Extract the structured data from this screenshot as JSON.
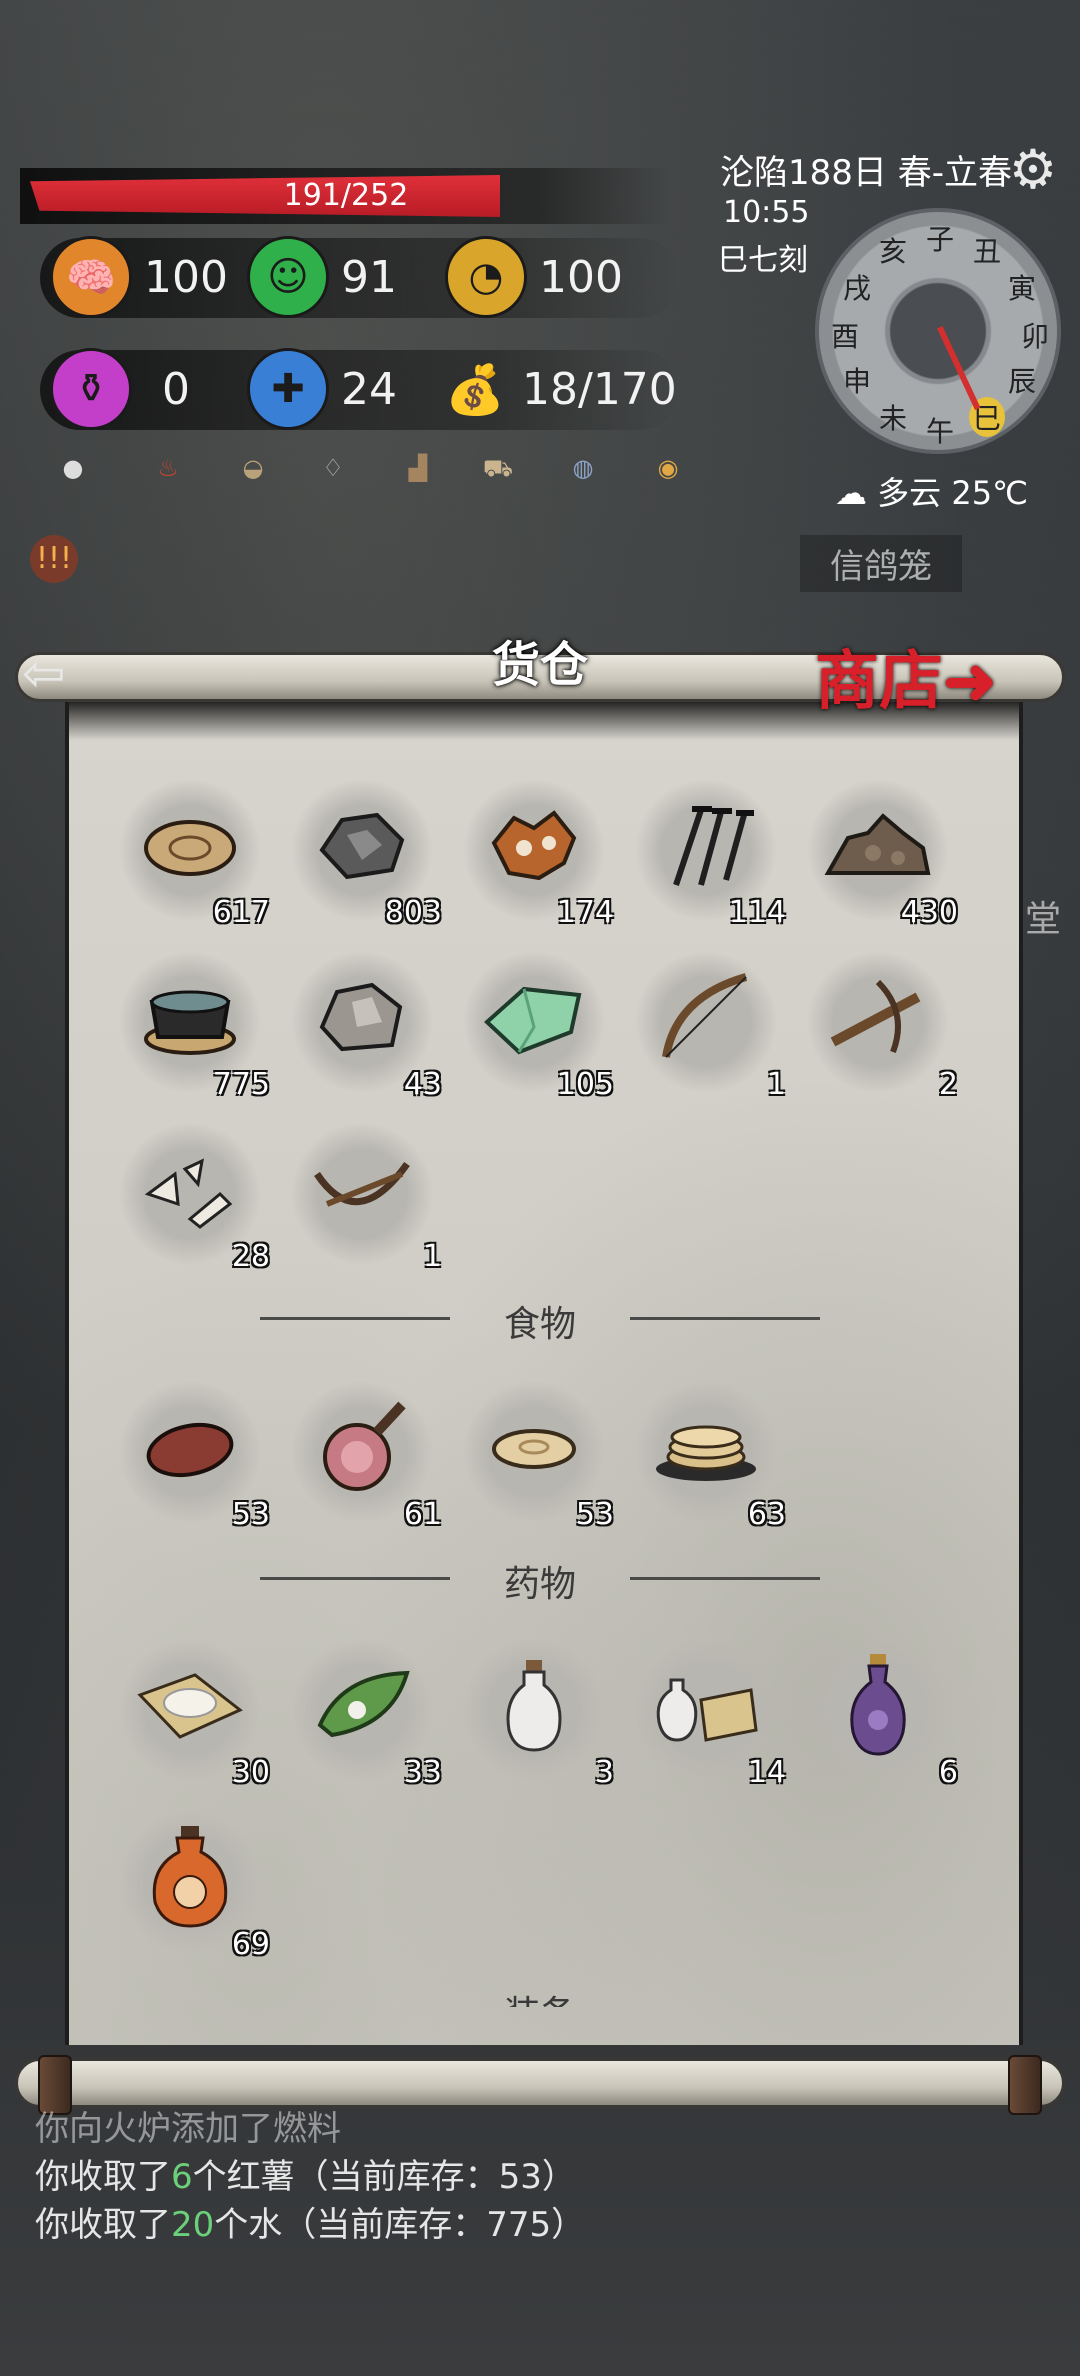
{
  "hud": {
    "hp": "191/252",
    "stats": [
      {
        "name": "brain-icon",
        "value": "100",
        "color": "#e2862c"
      },
      {
        "name": "smile-icon",
        "value": "91",
        "color": "#2fb04a"
      },
      {
        "name": "stomach-icon",
        "value": "100",
        "color": "#d9a52a"
      },
      {
        "name": "potion-icon",
        "value": "0",
        "color": "#c43fc9"
      },
      {
        "name": "bandage-icon",
        "value": "24",
        "color": "#3a7fd6"
      },
      {
        "name": "sack-icon",
        "value": "18/170",
        "color": "#9aa6b4"
      }
    ],
    "mini_icons": [
      "pill-icon",
      "flame-icon",
      "bread-icon",
      "vase-icon",
      "boots-icon",
      "cart-icon",
      "bag-icon",
      "lantern-icon"
    ],
    "warning_badge": "!!!"
  },
  "clock": {
    "date": "沦陷188日 春-立春",
    "time": "10:55",
    "shichen": "巳七刻",
    "weather": "多云",
    "temperature": "25℃",
    "dial_chars": [
      "子",
      "丑",
      "寅",
      "卯",
      "辰",
      "巳",
      "午",
      "未",
      "申",
      "酉",
      "戌",
      "亥"
    ]
  },
  "map": {
    "cage_label": "信鸽笼",
    "side_label": "堂"
  },
  "panel": {
    "title": "货仓",
    "shop_label": "商店➜",
    "materials": [
      {
        "name": "wood-slice",
        "count": "617",
        "glyph": "🪵"
      },
      {
        "name": "coal",
        "count": "803",
        "glyph": "🪨"
      },
      {
        "name": "leather",
        "count": "174",
        "glyph": "🦊"
      },
      {
        "name": "nails",
        "count": "114",
        "glyph": "📌"
      },
      {
        "name": "ore-pile",
        "count": "430",
        "glyph": "⛰"
      },
      {
        "name": "water-bowl",
        "count": "775",
        "glyph": "🥣"
      },
      {
        "name": "stone",
        "count": "43",
        "glyph": "🪨"
      },
      {
        "name": "jade",
        "count": "105",
        "glyph": "💎"
      },
      {
        "name": "bow",
        "count": "1",
        "glyph": "🏹"
      },
      {
        "name": "crossbow",
        "count": "2",
        "glyph": "⚔"
      },
      {
        "name": "shards",
        "count": "28",
        "glyph": "✂"
      },
      {
        "name": "small-crossbow",
        "count": "1",
        "glyph": "🏹"
      }
    ],
    "food_header": "食物",
    "food": [
      {
        "name": "sweet-potato",
        "count": "53",
        "glyph": "🍠"
      },
      {
        "name": "ham",
        "count": "61",
        "glyph": "🍖"
      },
      {
        "name": "flatbread",
        "count": "53",
        "glyph": "🫓"
      },
      {
        "name": "pancake-stack",
        "count": "63",
        "glyph": "🥞"
      }
    ],
    "medicine_header": "药物",
    "medicine": [
      {
        "name": "herb-powder",
        "count": "30",
        "glyph": "📜"
      },
      {
        "name": "herb-leaf",
        "count": "33",
        "glyph": "🍃"
      },
      {
        "name": "white-bottle",
        "count": "3",
        "glyph": "⚱"
      },
      {
        "name": "bottle-and-scroll",
        "count": "14",
        "glyph": "⚗"
      },
      {
        "name": "purple-vase",
        "count": "6",
        "glyph": "🏺"
      },
      {
        "name": "orange-jar",
        "count": "69",
        "glyph": "🏺"
      }
    ],
    "cut_header": "装备"
  },
  "log": [
    {
      "pre": "你向火炉添加了燃料",
      "num": "",
      "mid": "",
      "tail": ""
    },
    {
      "pre": "你收取了",
      "num": "6",
      "mid": "个红薯",
      "tail": "（当前库存：53）"
    },
    {
      "pre": "你收取了",
      "num": "20",
      "mid": "个水",
      "tail": "（当前库存：775）"
    }
  ]
}
